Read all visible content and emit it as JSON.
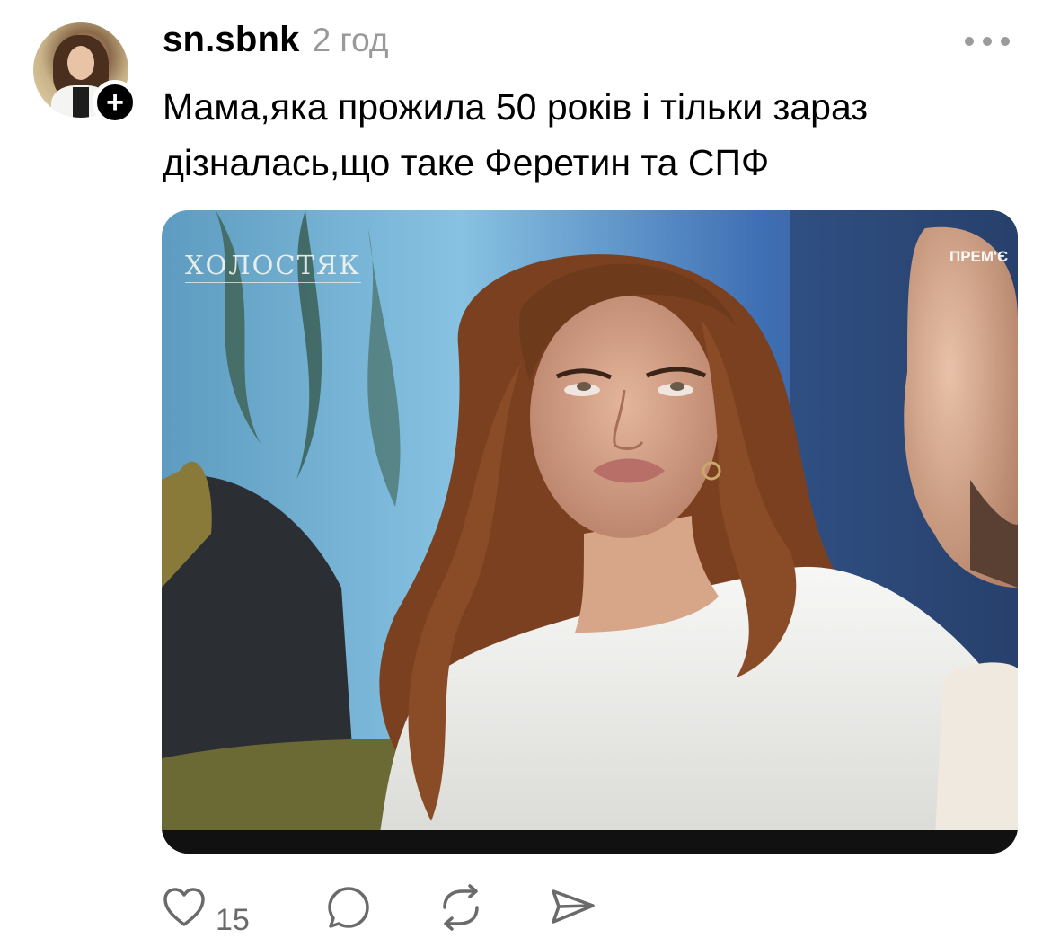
{
  "post": {
    "username": "sn.sbnk",
    "timestamp": "2 год",
    "text": "Мама,яка прожила 50 років і тільки зараз дізналась,що таке Феретин та СПФ",
    "follow_glyph": "+",
    "media": {
      "logo_text": "ХОЛОСТЯК",
      "badge_text": "ПРЕМ'Є"
    },
    "actions": {
      "like_count": "15",
      "like_icon": "heart-icon",
      "comment_icon": "comment-icon",
      "repost_icon": "repost-icon",
      "share_icon": "share-icon"
    },
    "colors": {
      "text": "#000000",
      "secondary": "#999999",
      "icon": "#6a6a6a"
    }
  }
}
